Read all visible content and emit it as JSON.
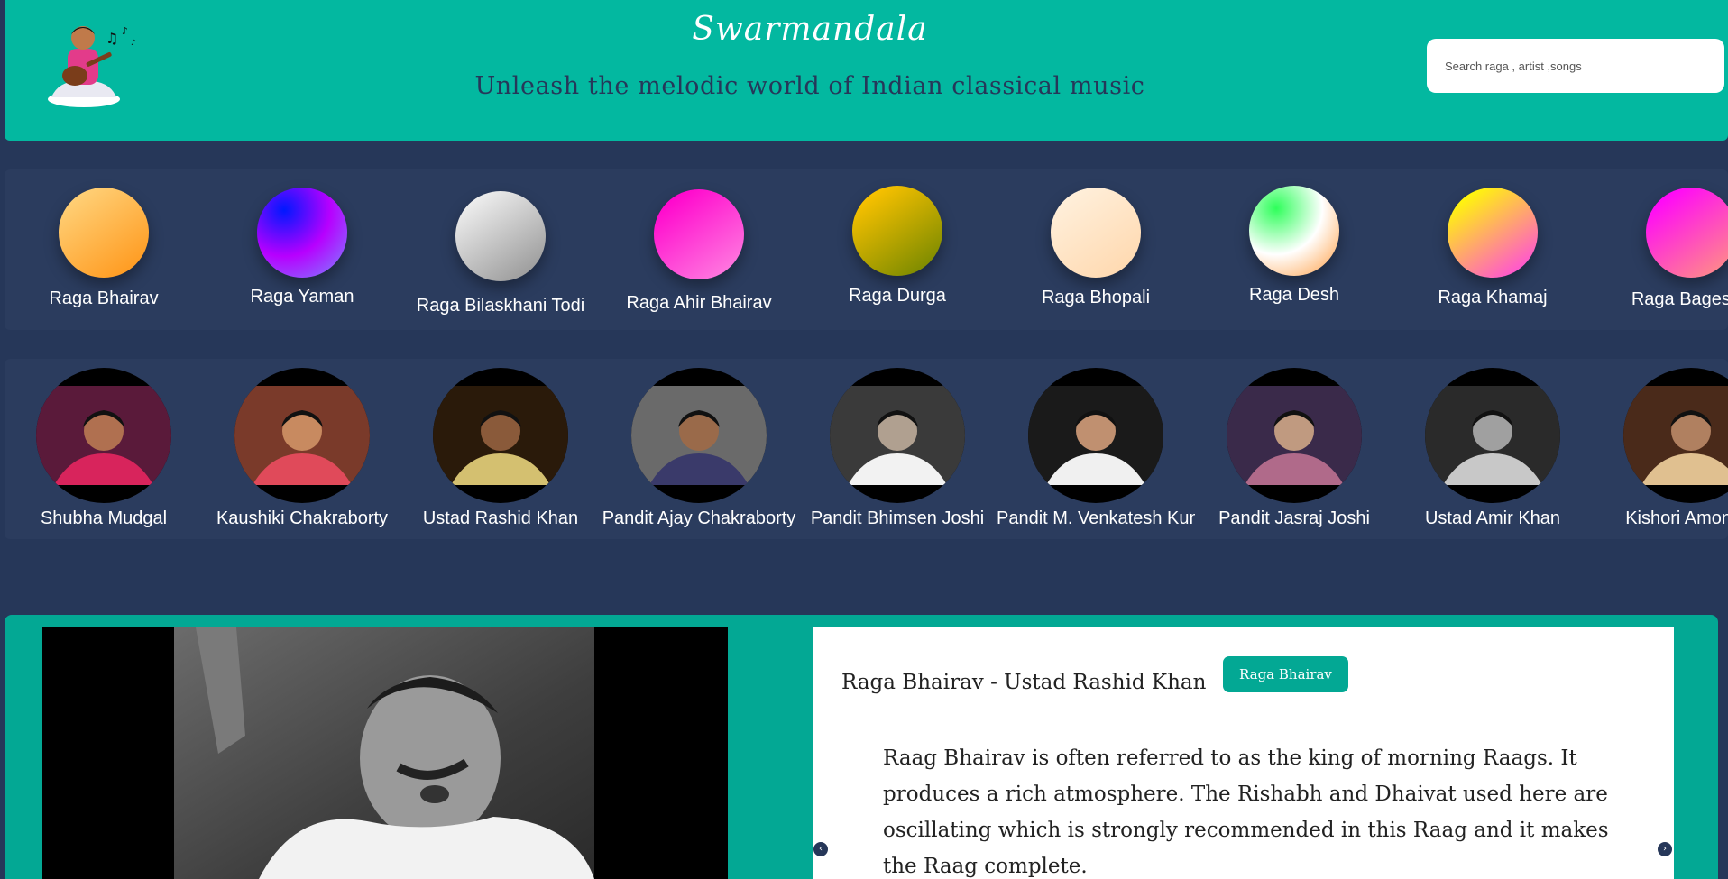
{
  "header": {
    "title": "Swarmandala",
    "tagline": "Unleash the melodic world of Indian classical music",
    "search_placeholder": "Search raga , artist ,songs"
  },
  "ragas": [
    {
      "name": "Raga Bhairav",
      "gradient": [
        "#ffd27a",
        "#ff9a1f"
      ]
    },
    {
      "name": "Raga Yaman",
      "gradient": [
        "#0018ff",
        "#b700ff",
        "#7a8cff"
      ]
    },
    {
      "name": "Raga Bilaskhani Todi",
      "gradient": [
        "#f2f2f2",
        "#9a9a9a"
      ]
    },
    {
      "name": "Raga Ahir Bhairav",
      "gradient": [
        "#ff00cc",
        "#ff7adf"
      ]
    },
    {
      "name": "Raga Durga",
      "gradient": [
        "#ffc400",
        "#7a8a00"
      ]
    },
    {
      "name": "Raga Bhopali",
      "gradient": [
        "#fff0dc",
        "#ffd9b0"
      ]
    },
    {
      "name": "Raga Desh",
      "gradient": [
        "#2eff5a",
        "#ffffff",
        "#ff9a3c"
      ]
    },
    {
      "name": "Raga Khamaj",
      "gradient": [
        "#ffff00",
        "#ff4fd8"
      ]
    },
    {
      "name": "Raga Bageshri",
      "gradient": [
        "#ff00ff",
        "#ff8a8a"
      ]
    }
  ],
  "artists": [
    {
      "name": "Shubha Mudgal",
      "icon": "artist-photo"
    },
    {
      "name": "Kaushiki Chakraborty",
      "icon": "artist-photo"
    },
    {
      "name": "Ustad Rashid Khan",
      "icon": "artist-photo"
    },
    {
      "name": "Pandit Ajay Chakraborty",
      "icon": "artist-photo"
    },
    {
      "name": "Pandit Bhimsen Joshi",
      "icon": "artist-photo"
    },
    {
      "name": "Pandit M. Venkatesh Kumar",
      "icon": "artist-photo"
    },
    {
      "name": "Pandit Jasraj Joshi",
      "icon": "artist-photo"
    },
    {
      "name": "Ustad Amir Khan",
      "icon": "artist-photo"
    },
    {
      "name": "Kishori Amonkar",
      "icon": "artist-photo"
    }
  ],
  "featured": {
    "title": "Raga Bhairav - Ustad Rashid Khan",
    "badge": "Raga Bhairav",
    "description": "Raag Bhairav is often referred to as the king of morning Raags. It produces a rich atmosphere. The Rishabh and Dhaivat used here are oscillating which is strongly recommended in this Raag and it makes the Raag complete."
  },
  "colors": {
    "teal": "#03b8a0",
    "navy": "#263759"
  }
}
